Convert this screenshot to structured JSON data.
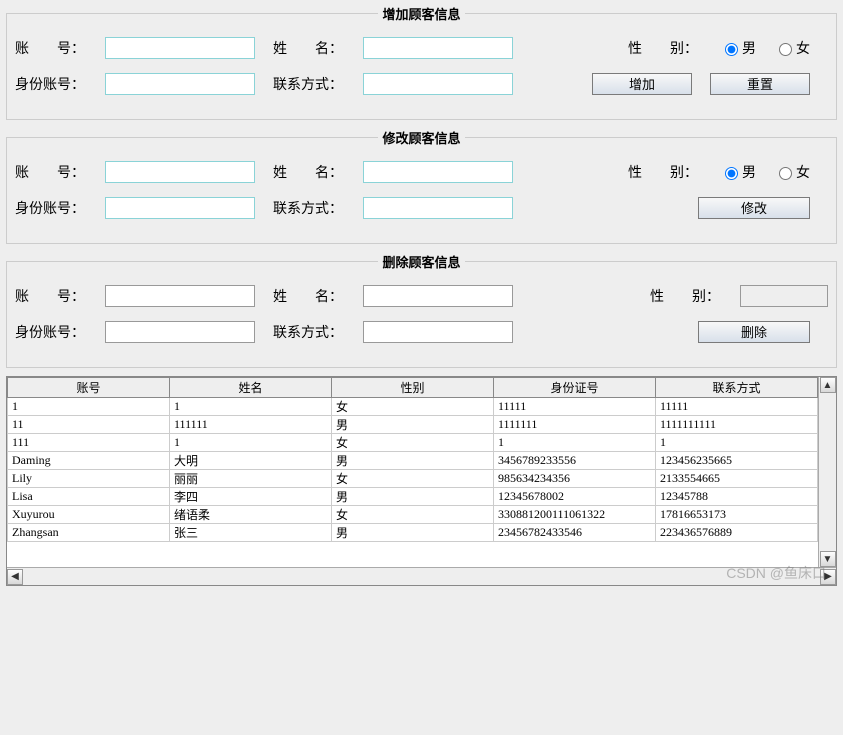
{
  "panels": {
    "add": {
      "legend": "增加顾客信息",
      "account_label": "账　　号：",
      "name_label": "姓　　名：",
      "gender_label": "性　　别：",
      "male": "男",
      "female": "女",
      "id_label": "身份账号：",
      "contact_label": "联系方式：",
      "add_btn": "增加",
      "reset_btn": "重置",
      "gender_selected": "male"
    },
    "modify": {
      "legend": "修改顾客信息",
      "account_label": "账　　号：",
      "name_label": "姓　　名：",
      "gender_label": "性　　别：",
      "male": "男",
      "female": "女",
      "id_label": "身份账号：",
      "contact_label": "联系方式：",
      "modify_btn": "修改",
      "gender_selected": "male"
    },
    "delete": {
      "legend": "删除顾客信息",
      "account_label": "账　　号：",
      "name_label": "姓　　名：",
      "gender_label": "性　　别：",
      "id_label": "身份账号：",
      "contact_label": "联系方式：",
      "delete_btn": "删除"
    }
  },
  "table": {
    "headers": [
      "账号",
      "姓名",
      "性别",
      "身份证号",
      "联系方式"
    ],
    "rows": [
      [
        "1",
        "1",
        "女",
        "11111",
        "11111"
      ],
      [
        "11",
        "111111",
        "男",
        "1111111",
        "1111111111"
      ],
      [
        "111",
        "1",
        "女",
        "1",
        "1"
      ],
      [
        "Daming",
        "大明",
        "男",
        "3456789233556",
        "123456235665"
      ],
      [
        "Lily",
        "丽丽",
        "女",
        "985634234356",
        "2133554665"
      ],
      [
        "Lisa",
        "李四",
        "男",
        "12345678002",
        "12345788"
      ],
      [
        "Xuyurou",
        "绪语柔",
        "女",
        "330881200111061322",
        "17816653173"
      ],
      [
        "Zhangsan",
        "张三",
        "男",
        "23456782433546",
        "223436576889"
      ]
    ]
  },
  "watermark": "CSDN @鱼床口"
}
